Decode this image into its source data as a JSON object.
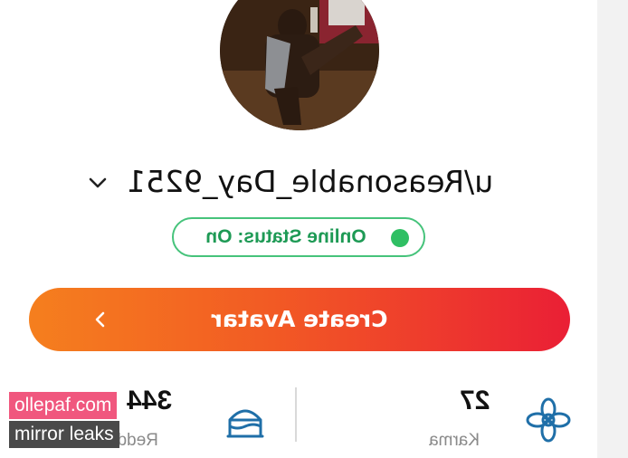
{
  "profile": {
    "username": "u/Reasonable_Day_9251",
    "online_status": "Online Status: On"
  },
  "actions": {
    "create_avatar_label": "Create Avatar"
  },
  "stats": {
    "karma_value": "27",
    "karma_label": "Karma",
    "reddit_value": "344",
    "reddit_label": "Reddit"
  },
  "watermark": {
    "line1": "ollepaf.com",
    "line2": "mirror leaks"
  },
  "colors": {
    "accent_gradient_start": "#f57f1e",
    "accent_gradient_end": "#ea1f35",
    "status_green": "#2fbf63",
    "watermark_pink": "#f0577e"
  },
  "icons": {
    "username_dropdown": "chevron-down-icon",
    "create_avatar_arrow": "chevron-left-icon",
    "karma": "flower-icon",
    "reddit_age": "cake-icon",
    "status": "online-dot-icon"
  }
}
